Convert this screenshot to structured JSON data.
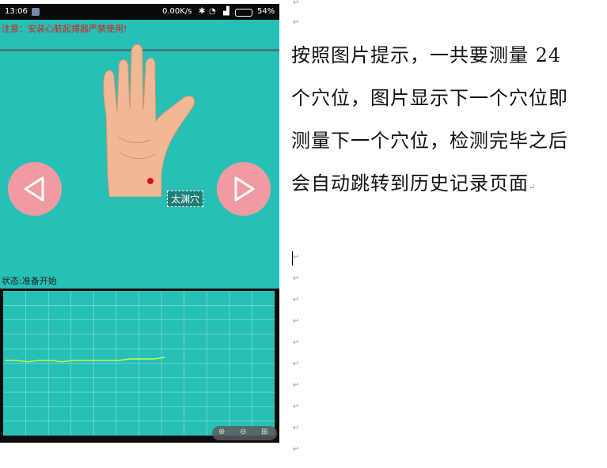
{
  "status_bar": {
    "time": "13:06",
    "net_speed": "0.00K/s",
    "battery": "54%"
  },
  "app": {
    "warning": "注意：安装心脏起搏器严禁使用!",
    "point_label": "太渊穴",
    "status_text": "状态:准备开始",
    "colors": {
      "background": "#26c0b6",
      "nav_button": "#f29aa1",
      "warning": "#d61c1c",
      "signal": "#d6f55a"
    }
  },
  "chart_data": {
    "type": "line",
    "grid": true,
    "series": [
      {
        "values": [
          0.52,
          0.52,
          0.51,
          0.52,
          0.52,
          0.51,
          0.52,
          0.52,
          0.52,
          0.52,
          0.52,
          0.53,
          0.53,
          0.53,
          0.54
        ]
      }
    ]
  },
  "document": {
    "paragraph": "按照图片提示，一共要测量 24 个穴位，图片显示下一个穴位即测量下一个穴位，检测完毕之后会自动跳转到历史记录页面",
    "para_mark": "↵"
  }
}
